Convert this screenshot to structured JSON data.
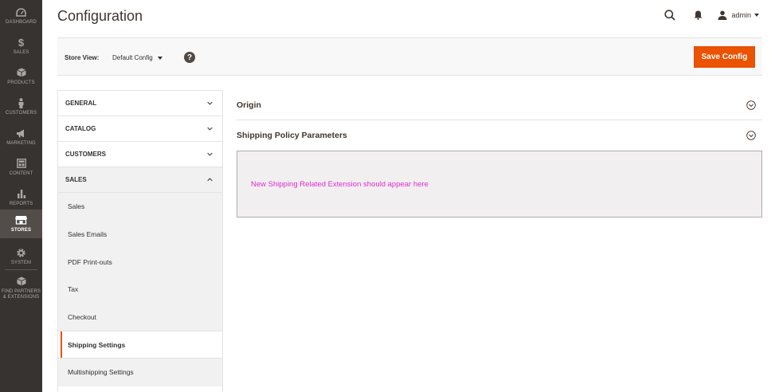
{
  "nav": {
    "items": [
      {
        "label": "DASHBOARD",
        "icon": "dashboard-icon"
      },
      {
        "label": "SALES",
        "icon": "dollar-icon"
      },
      {
        "label": "PRODUCTS",
        "icon": "cube-icon"
      },
      {
        "label": "CUSTOMERS",
        "icon": "person-icon"
      },
      {
        "label": "MARKETING",
        "icon": "megaphone-icon"
      },
      {
        "label": "CONTENT",
        "icon": "layout-icon"
      },
      {
        "label": "REPORTS",
        "icon": "bar-chart-icon"
      },
      {
        "label": "STORES",
        "icon": "storefront-icon",
        "active": true
      },
      {
        "label": "SYSTEM",
        "icon": "gear-icon"
      },
      {
        "label": "FIND PARTNERS & EXTENSIONS",
        "icon": "boxes-icon"
      }
    ]
  },
  "header": {
    "title": "Configuration",
    "user": "admin"
  },
  "store_bar": {
    "label": "Store View:",
    "selected": "Default Config",
    "help": "?",
    "save_label": "Save Config"
  },
  "config_nav": {
    "sections": [
      {
        "label": "GENERAL"
      },
      {
        "label": "CATALOG"
      },
      {
        "label": "CUSTOMERS"
      },
      {
        "label": "SALES"
      }
    ],
    "sales_items": [
      "Sales",
      "Sales Emails",
      "PDF Print-outs",
      "Tax",
      "Checkout",
      "Shipping Settings",
      "Multishipping Settings"
    ]
  },
  "main": {
    "groups": [
      {
        "label": "Origin"
      },
      {
        "label": "Shipping Policy Parameters"
      }
    ],
    "extension_note": "New Shipping Related Extension should appear here"
  },
  "colors": {
    "nav_bg": "#373330",
    "accent": "#eb5202",
    "note": "#e22ad6"
  }
}
